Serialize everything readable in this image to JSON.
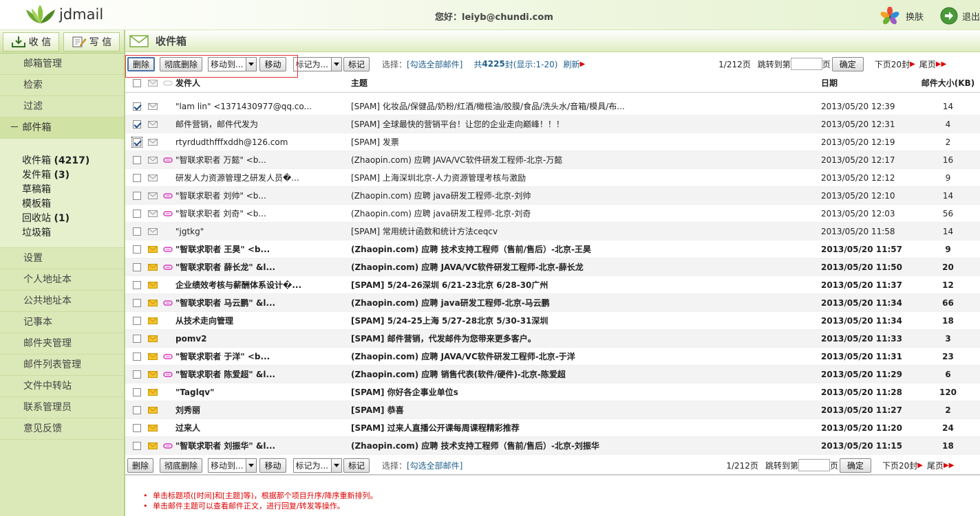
{
  "app": {
    "brand": "jdmail"
  },
  "header": {
    "greeting": "您好：leiyb@chundi.com",
    "skin_label": "换肤",
    "logout_label": "退出"
  },
  "sidebar": {
    "tabs": [
      {
        "label": "收 信",
        "icon": "inbox-download-icon"
      },
      {
        "label": "写 信",
        "icon": "compose-icon"
      }
    ],
    "top_items": [
      {
        "label": "邮箱管理"
      },
      {
        "label": "检索"
      },
      {
        "label": "过滤"
      }
    ],
    "mailbox_header": "－ 邮件箱",
    "folders": [
      {
        "name": "收件箱",
        "count": "(4217)"
      },
      {
        "name": "发件箱",
        "count": "(3)"
      },
      {
        "name": "草稿箱",
        "count": ""
      },
      {
        "name": "模板箱",
        "count": ""
      },
      {
        "name": "回收站",
        "count": "(1)"
      },
      {
        "name": "垃圾箱",
        "count": ""
      }
    ],
    "bottom_items": [
      {
        "label": "设置"
      },
      {
        "label": "个人地址本"
      },
      {
        "label": "公共地址本"
      },
      {
        "label": "记事本"
      },
      {
        "label": "邮件夹管理"
      },
      {
        "label": "邮件列表管理"
      },
      {
        "label": "文件中转站"
      },
      {
        "label": "联系管理员"
      },
      {
        "label": "意见反馈"
      }
    ]
  },
  "main": {
    "title": "收件箱",
    "toolbar": {
      "delete": "删除",
      "perm_delete": "彻底删除",
      "move_select": "移动到...",
      "move": "移动",
      "mark_select": "标记为...",
      "mark": "标记",
      "select_label": "选择：",
      "select_all": "[勾选全部邮件]",
      "total_prefix": "共",
      "total_count": "4225",
      "total_suffix": "封(显示:1-20)",
      "refresh": "刷新",
      "page_info": "1/212页",
      "jump_label": "跳转到第",
      "page_unit": "页",
      "confirm": "确定",
      "next": "下页20封",
      "last": "尾页"
    },
    "columns": {
      "from": "发件人",
      "subject": "主题",
      "date": "日期",
      "size": "邮件大小(KB)"
    },
    "rows": [
      {
        "checked": true,
        "unread": false,
        "tag": false,
        "from": "\"lam lin\" <1371430977@qq.co...",
        "subject": "[SPAM] 化妆品/保健品/奶粉/红酒/橄榄油/胶膜/食品/洗头水/音箱/模具/布...",
        "date": "2013/05/20 12:39",
        "size": "14"
      },
      {
        "checked": true,
        "unread": false,
        "tag": false,
        "from": "邮件营销，邮件代发为",
        "subject": "[SPAM] 全球最快的营销平台！让您的企业走向巅峰！！！",
        "date": "2013/05/20 12:31",
        "size": "4"
      },
      {
        "checked": true,
        "unread": false,
        "tag": false,
        "from": "rtyrdudthfffxddh@126.com",
        "subject": "[SPAM] 发票",
        "date": "2013/05/20 12:19",
        "size": "2"
      },
      {
        "checked": false,
        "unread": false,
        "tag": true,
        "from": "\"智联求职者 万懿\" <b...",
        "subject": "(Zhaopin.com) 应聘 JAVA/VC软件研发工程师-北京-万懿",
        "date": "2013/05/20 12:17",
        "size": "16"
      },
      {
        "checked": false,
        "unread": false,
        "tag": false,
        "from": "研发人力资源管理之研发人员�...",
        "subject": "[SPAM] 上海深圳北京-人力资源管理考核与激励",
        "date": "2013/05/20 12:12",
        "size": "9"
      },
      {
        "checked": false,
        "unread": false,
        "tag": true,
        "from": "\"智联求职者 刘帅\" <b...",
        "subject": "(Zhaopin.com) 应聘 java研发工程师-北京-刘帅",
        "date": "2013/05/20 12:10",
        "size": "14"
      },
      {
        "checked": false,
        "unread": false,
        "tag": true,
        "from": "\"智联求职者 刘奇\" <b...",
        "subject": "(Zhaopin.com) 应聘 java研发工程师-北京-刘奇",
        "date": "2013/05/20 12:03",
        "size": "56"
      },
      {
        "checked": false,
        "unread": false,
        "tag": false,
        "from": "\"jgtkg\"",
        "subject": "[SPAM] 常用统计函数和统计方法ceqcv",
        "date": "2013/05/20 11:58",
        "size": "14"
      },
      {
        "checked": false,
        "unread": true,
        "tag": true,
        "from": "\"智联求职者 王昊\" <b...",
        "subject": "(Zhaopin.com) 应聘 技术支持工程师（售前/售后）-北京-王昊",
        "date": "2013/05/20 11:57",
        "size": "9"
      },
      {
        "checked": false,
        "unread": true,
        "tag": true,
        "from": "\"智联求职者 薛长龙\" &l...",
        "subject": "(Zhaopin.com) 应聘 JAVA/VC软件研发工程师-北京-薛长龙",
        "date": "2013/05/20 11:50",
        "size": "20"
      },
      {
        "checked": false,
        "unread": true,
        "tag": false,
        "from": "企业绩效考核与薪酬体系设计�...",
        "subject": "[SPAM] 5/24-26深圳 6/21-23北京 6/28-30广州",
        "date": "2013/05/20 11:37",
        "size": "12"
      },
      {
        "checked": false,
        "unread": true,
        "tag": true,
        "from": "\"智联求职者 马云鹏\" &l...",
        "subject": "(Zhaopin.com) 应聘 java研发工程师-北京-马云鹏",
        "date": "2013/05/20 11:34",
        "size": "66"
      },
      {
        "checked": false,
        "unread": true,
        "tag": false,
        "from": "从技术走向管理",
        "subject": "[SPAM] 5/24-25上海 5/27-28北京 5/30-31深圳",
        "date": "2013/05/20 11:34",
        "size": "18"
      },
      {
        "checked": false,
        "unread": true,
        "tag": false,
        "from": "pomv2",
        "subject": "[SPAM] 邮件营销，代发邮件为您带来更多客户。",
        "date": "2013/05/20 11:33",
        "size": "3"
      },
      {
        "checked": false,
        "unread": true,
        "tag": true,
        "from": "\"智联求职者 于洋\" <b...",
        "subject": "(Zhaopin.com) 应聘 JAVA/VC软件研发工程师-北京-于洋",
        "date": "2013/05/20 11:31",
        "size": "23"
      },
      {
        "checked": false,
        "unread": true,
        "tag": true,
        "from": "\"智联求职者 陈爱超\" &l...",
        "subject": "(Zhaopin.com) 应聘 销售代表(软件/硬件)-北京-陈爱超",
        "date": "2013/05/20 11:29",
        "size": "6"
      },
      {
        "checked": false,
        "unread": true,
        "tag": false,
        "from": "\"Taglqv\"",
        "subject": "[SPAM] 你好各企事业单位s",
        "date": "2013/05/20 11:28",
        "size": "120"
      },
      {
        "checked": false,
        "unread": true,
        "tag": false,
        "from": "刘秀丽",
        "subject": "[SPAM] 恭喜",
        "date": "2013/05/20 11:27",
        "size": "2"
      },
      {
        "checked": false,
        "unread": true,
        "tag": false,
        "from": "过来人",
        "subject": "[SPAM] 过来人直播公开课每周课程精彩推荐",
        "date": "2013/05/20 11:20",
        "size": "24"
      },
      {
        "checked": false,
        "unread": true,
        "tag": true,
        "from": "\"智联求职者 刘振华\" &l...",
        "subject": "(Zhaopin.com) 应聘 技术支持工程师（售前/售后）-北京-刘振华",
        "date": "2013/05/20 11:15",
        "size": "18"
      }
    ],
    "notes": [
      "单击标题项([时间]和[主题]等)，根据那个项目升序/降序重新排列。",
      "单击邮件主题可以查看邮件正文，进行回复/转发等操作。"
    ]
  },
  "colors": {
    "accent_green": "#8db84a",
    "sidebar_bg": "#dbe9b8",
    "note_red": "#dd0000",
    "link_blue": "#1d5e8c",
    "tag_pink": "#d63bbf",
    "unread_envelope": "#e7b400"
  }
}
